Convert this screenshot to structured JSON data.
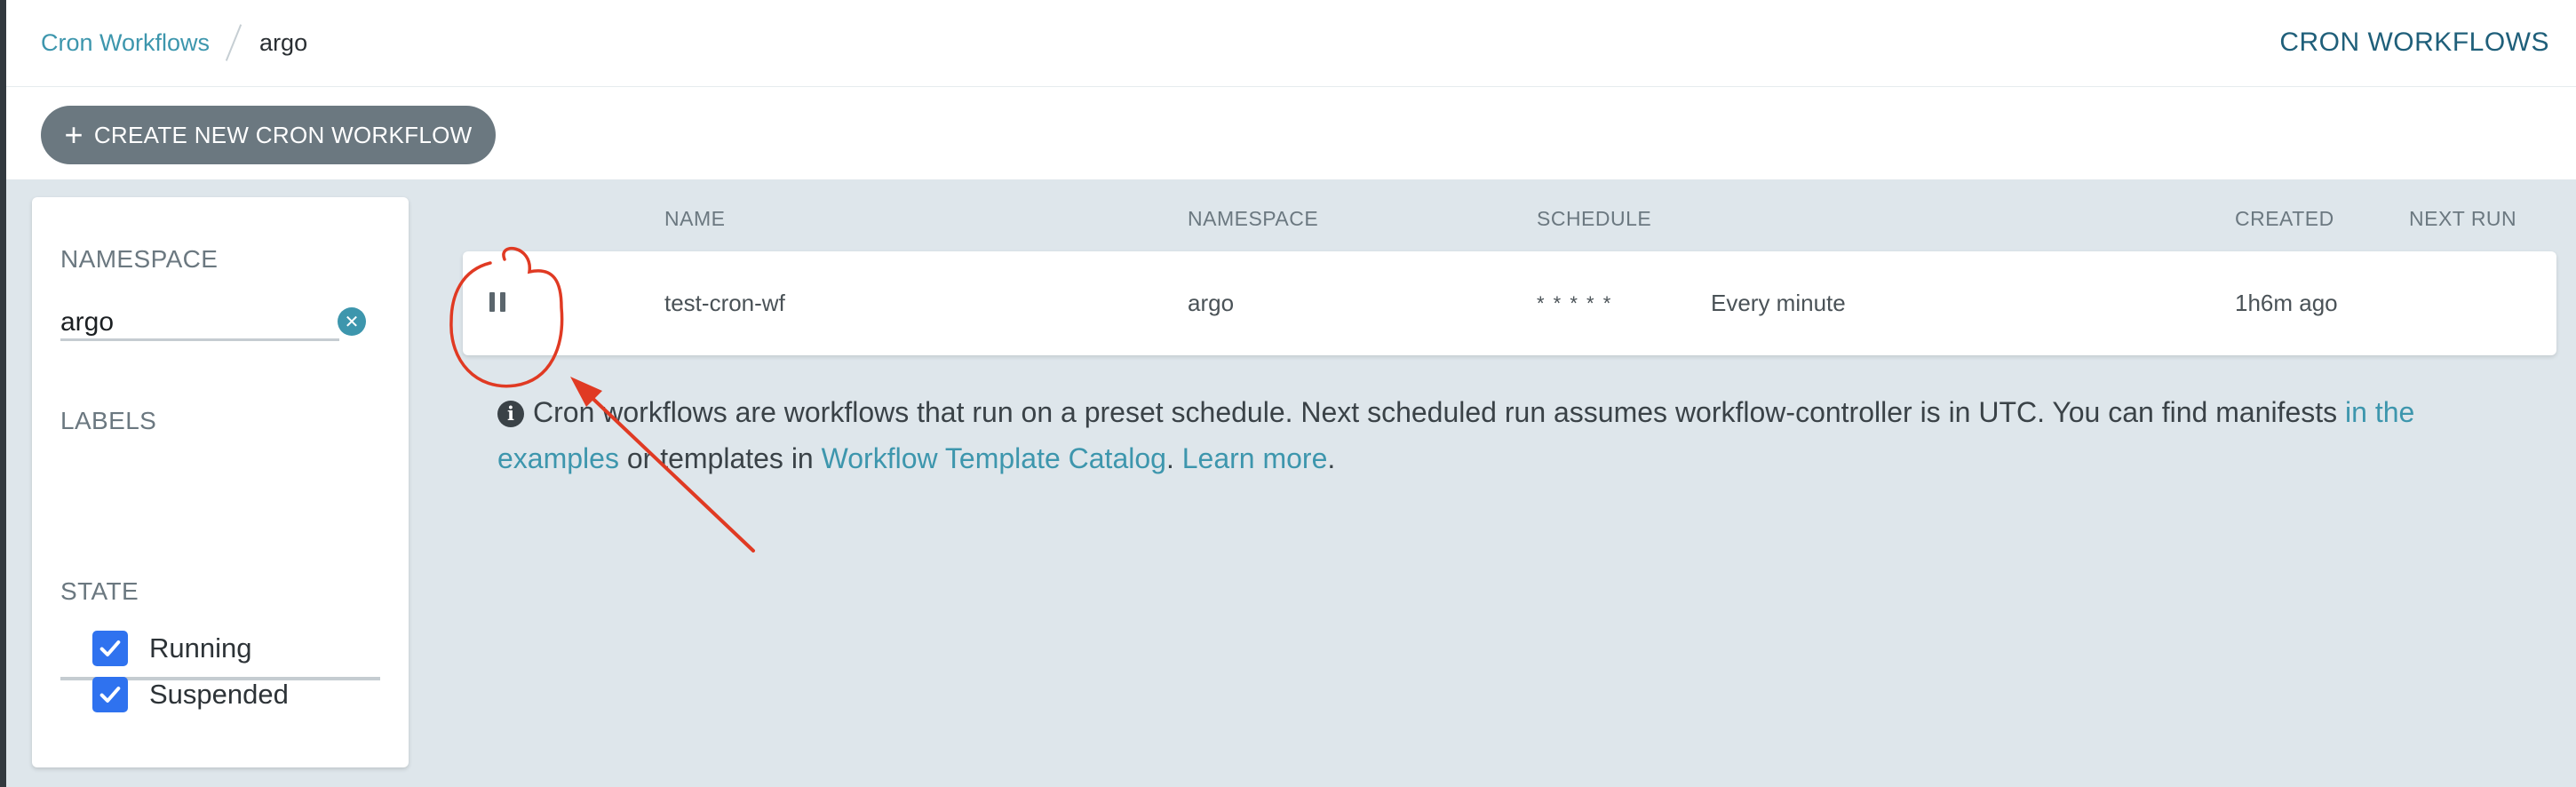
{
  "breadcrumb": {
    "parent": "Cron Workflows",
    "current": "argo"
  },
  "page_title": "CRON WORKFLOWS",
  "toolbar": {
    "create_label": "CREATE NEW CRON WORKFLOW",
    "create_icon": "plus-icon"
  },
  "filters": {
    "namespace_label": "NAMESPACE",
    "namespace_value": "argo",
    "labels_label": "LABELS",
    "state_label": "STATE",
    "states": [
      {
        "label": "Running",
        "checked": true
      },
      {
        "label": "Suspended",
        "checked": true
      }
    ]
  },
  "table": {
    "columns": {
      "name": "NAME",
      "namespace": "NAMESPACE",
      "schedule": "SCHEDULE",
      "created": "CREATED",
      "next_run": "NEXT RUN"
    },
    "rows": [
      {
        "status_icon": "pause-icon",
        "name": "test-cron-wf",
        "namespace": "argo",
        "schedule": "* * * * *",
        "schedule_human": "Every minute",
        "created": "1h6m ago",
        "next_run": ""
      }
    ]
  },
  "info": {
    "text1": "Cron workflows are workflows that run on a preset schedule. Next scheduled run assumes workflow-controller is in UTC. You can find manifests ",
    "link1": "in the examples",
    "text2": " or templates in ",
    "link2": "Workflow Template Catalog",
    "text3": ". ",
    "link3": "Learn more",
    "text4": "."
  },
  "colors": {
    "accent": "#3d96ad",
    "button_bg": "#6b7880",
    "checkbox": "#2f72ef",
    "annotation": "#e03a23",
    "background": "#dee6eb"
  }
}
